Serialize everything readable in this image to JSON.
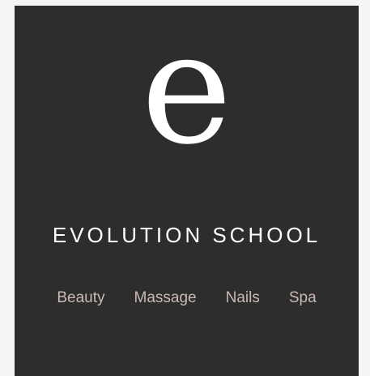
{
  "logo": {
    "glyph": "e"
  },
  "brand": {
    "title": "EVOLUTION SCHOOL"
  },
  "nav": {
    "items": [
      {
        "label": "Beauty"
      },
      {
        "label": "Massage"
      },
      {
        "label": "Nails"
      },
      {
        "label": "Spa"
      }
    ]
  },
  "colors": {
    "background": "#2d2d2d",
    "text": "#ffffff",
    "nav_text": "#cbb9b4",
    "page_background": "#f6f5f3"
  }
}
